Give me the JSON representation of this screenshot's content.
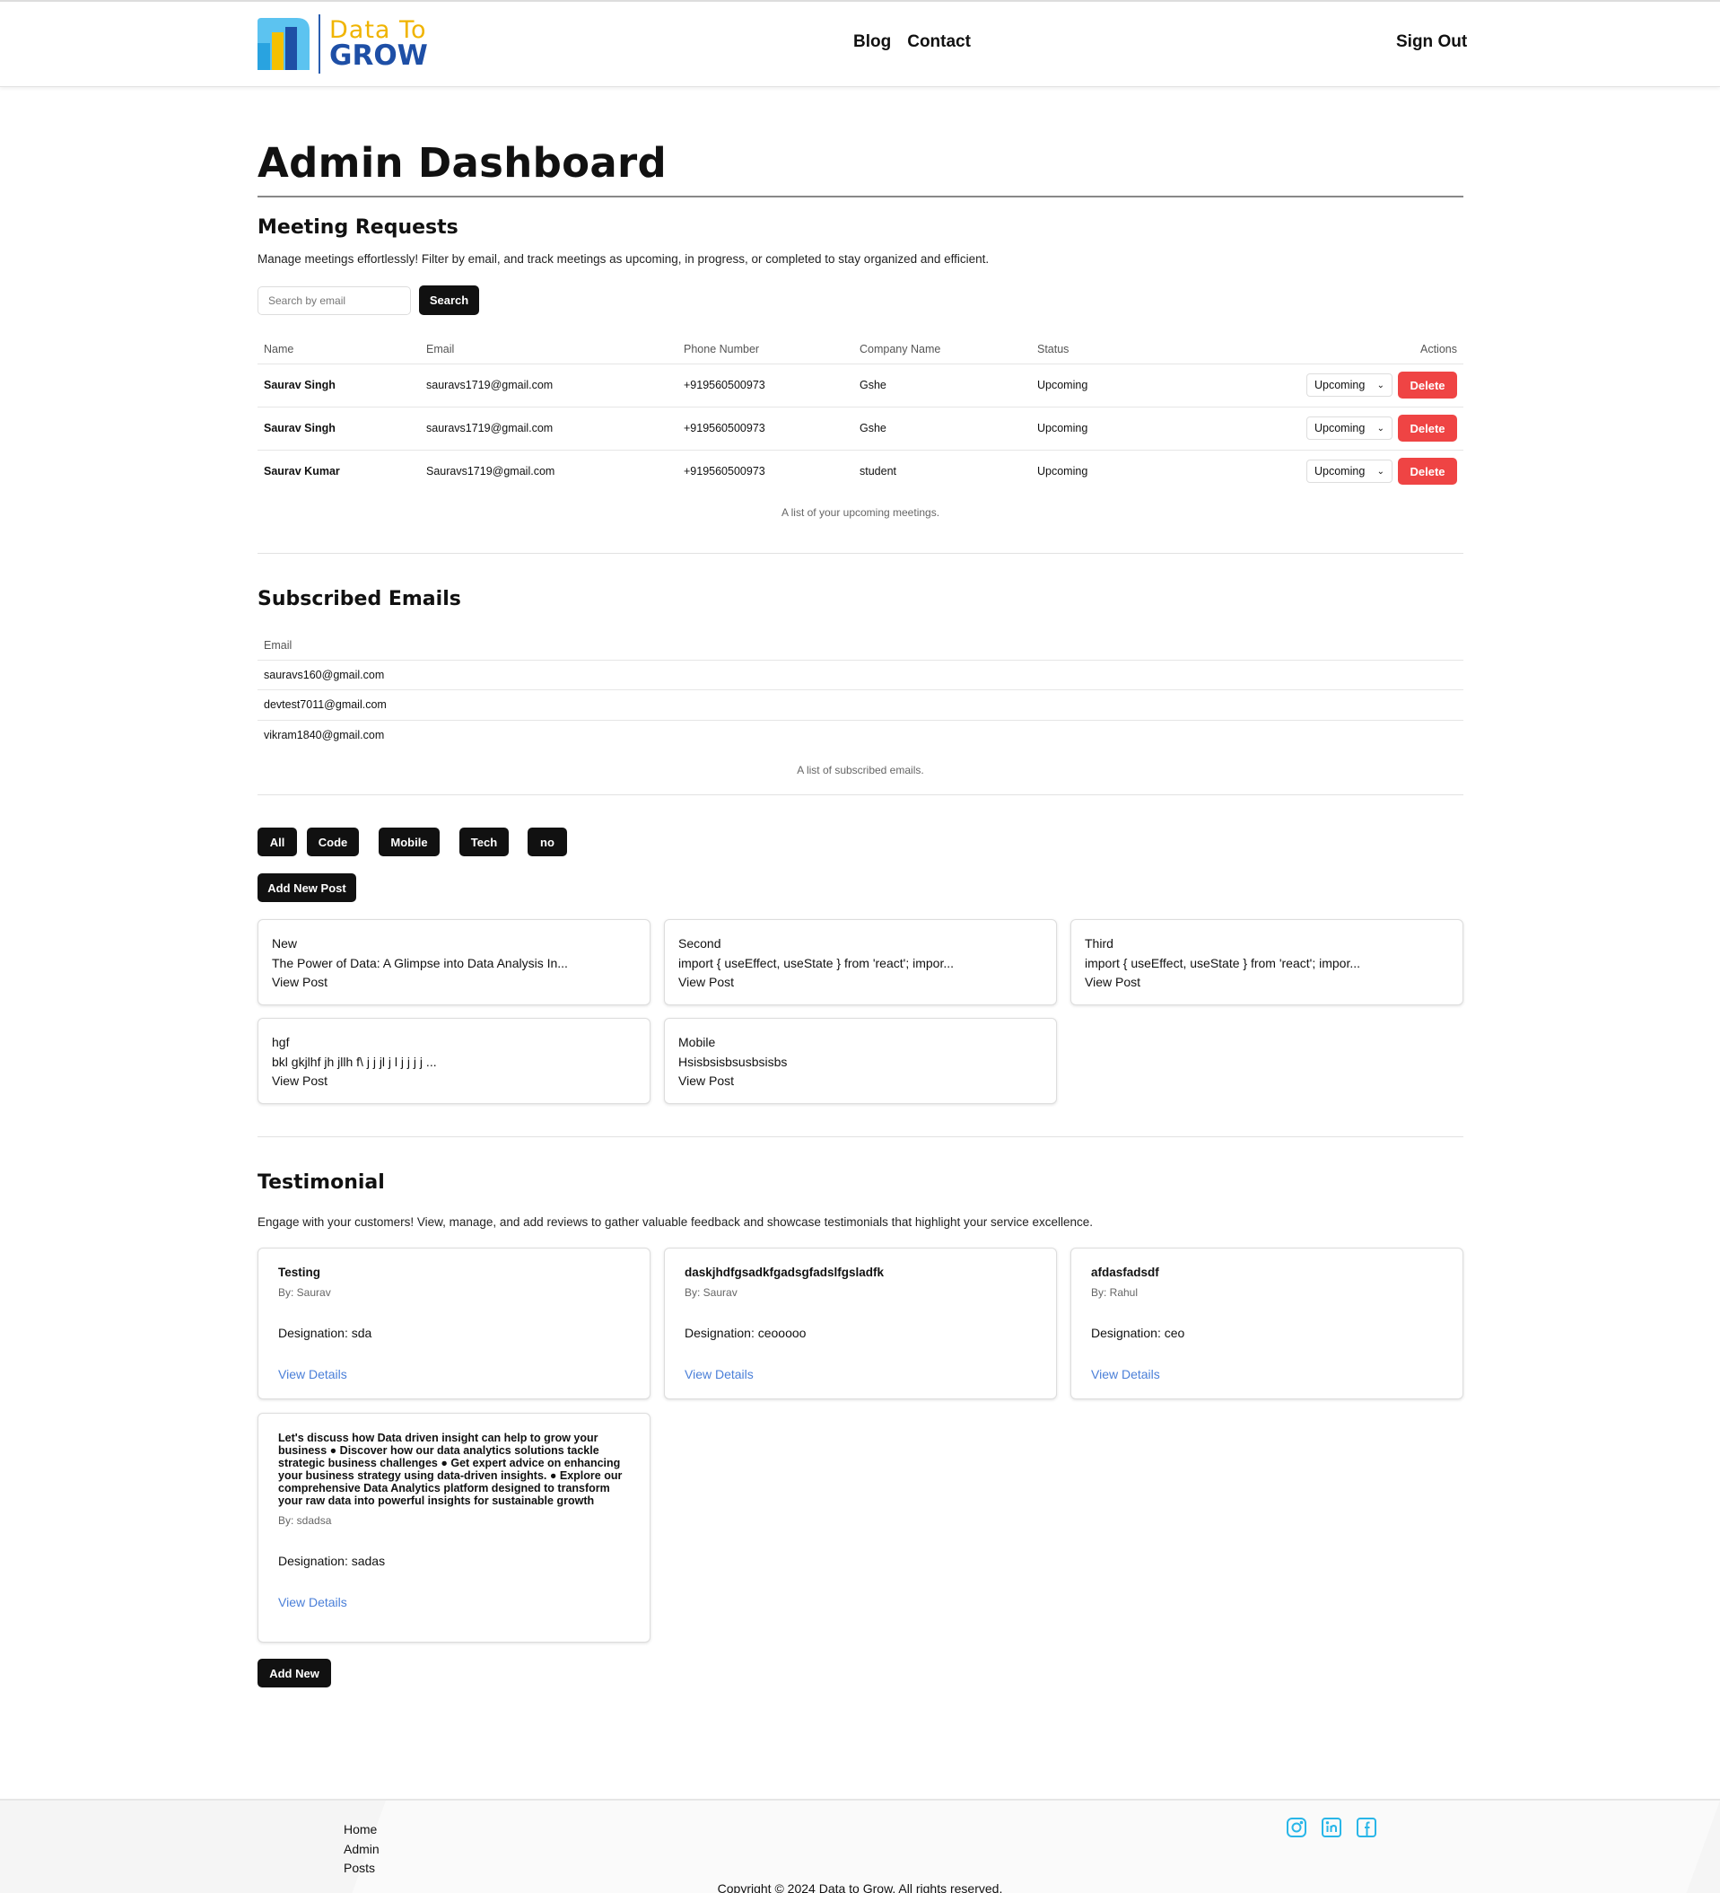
{
  "header": {
    "logo_line1": "Data To",
    "logo_line2": "GROW",
    "nav": [
      "Blog",
      "Contact"
    ],
    "sign_out": "Sign Out"
  },
  "page_title": "Admin Dashboard",
  "meetings": {
    "title": "Meeting Requests",
    "description": "Manage meetings effortlessly! Filter by email, and track meetings as upcoming, in progress, or completed to stay organized and efficient.",
    "search_placeholder": "Search by email",
    "search_button": "Search",
    "columns": [
      "Name",
      "Email",
      "Phone Number",
      "Company Name",
      "Status",
      "Actions"
    ],
    "rows": [
      {
        "name": "Saurav Singh",
        "email": "sauravs1719@gmail.com",
        "phone": "+919560500973",
        "company": "Gshe",
        "status": "Upcoming",
        "select": "Upcoming",
        "delete": "Delete"
      },
      {
        "name": "Saurav Singh",
        "email": "sauravs1719@gmail.com",
        "phone": "+919560500973",
        "company": "Gshe",
        "status": "Upcoming",
        "select": "Upcoming",
        "delete": "Delete"
      },
      {
        "name": "Saurav Kumar",
        "email": "Sauravs1719@gmail.com",
        "phone": "+919560500973",
        "company": "student",
        "status": "Upcoming",
        "select": "Upcoming",
        "delete": "Delete"
      }
    ],
    "caption": "A list of your upcoming meetings."
  },
  "subscribed": {
    "title": "Subscribed Emails",
    "column": "Email",
    "emails": [
      "sauravs160@gmail.com",
      "devtest7011@gmail.com",
      "vikram1840@gmail.com"
    ],
    "caption": "A list of subscribed emails."
  },
  "posts": {
    "filters": [
      "All",
      "Code",
      "Mobile",
      "Tech",
      "no"
    ],
    "add_button": "Add New Post",
    "items": [
      {
        "category": "New",
        "title": "The Power of Data: A Glimpse into Data Analysis In...",
        "link": "View Post"
      },
      {
        "category": "Second",
        "title": "import { useEffect, useState } from 'react'; impor...",
        "link": "View Post"
      },
      {
        "category": "Third",
        "title": "import { useEffect, useState } from 'react'; impor...",
        "link": "View Post"
      },
      {
        "category": "hgf",
        "title": "bkl gkjlhf jh jllh f\\ j j jl j l j j j j ...",
        "link": "View Post"
      },
      {
        "category": "Mobile",
        "title": "Hsisbsisbsusbsisbs",
        "link": "View Post"
      }
    ]
  },
  "testimonials": {
    "title": "Testimonial",
    "description": "Engage with your customers! View, manage, and add reviews to gather valuable feedback and showcase testimonials that highlight your service excellence.",
    "items": [
      {
        "title": "Testing",
        "by": "By: Saurav",
        "designation": "Designation: sda",
        "link": "View Details"
      },
      {
        "title": "daskjhdfgsadkfgadsgfadslfgsladfk",
        "by": "By: Saurav",
        "designation": "Designation: ceooooo",
        "link": "View Details"
      },
      {
        "title": "afdasfadsdf",
        "by": "By: Rahul",
        "designation": "Designation: ceo",
        "link": "View Details"
      },
      {
        "title": "Let's discuss how Data driven insight can help to grow your business ● Discover how our data analytics solutions tackle strategic business challenges ● Get expert advice on enhancing your business strategy using data-driven insights. ● Explore our comprehensive Data Analytics platform designed to transform your raw data into powerful insights for sustainable growth",
        "by": "By: sdadsa",
        "designation": "Designation: sadas",
        "link": "View Details"
      }
    ],
    "add_button": "Add New"
  },
  "footer": {
    "links": [
      "Home",
      "Admin",
      "Posts"
    ],
    "social_icons": [
      "instagram-icon",
      "linkedin-icon",
      "facebook-icon"
    ],
    "accent_color": "#29b6e8",
    "copyright": "Copyright © 2024 Data to Grow. All rights reserved."
  },
  "colors": {
    "delete": "#ef4444",
    "link": "#4a7fd8",
    "dark_button": "#111111"
  }
}
